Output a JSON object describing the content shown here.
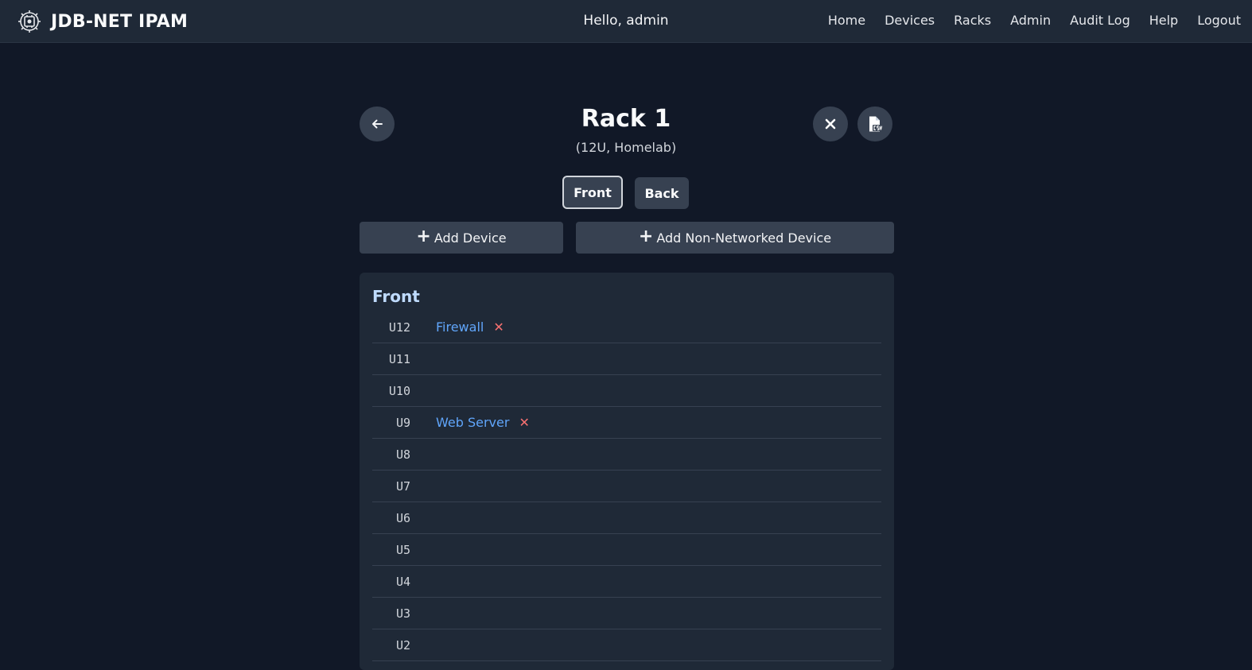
{
  "nav": {
    "brand": "JDB-NET IPAM",
    "greeting": "Hello, admin",
    "links": [
      "Home",
      "Devices",
      "Racks",
      "Admin",
      "Audit Log",
      "Help",
      "Logout"
    ]
  },
  "rack": {
    "title": "Rack 1",
    "subtitle": "(12U, Homelab)"
  },
  "views": {
    "front_label": "Front",
    "back_label": "Back",
    "active": "Front"
  },
  "actions": {
    "add_device": "Add Device",
    "add_non_networked": "Add Non-Networked Device"
  },
  "panel": {
    "title": "Front",
    "slots": [
      {
        "unit": "U12",
        "device": "Firewall"
      },
      {
        "unit": "U11",
        "device": ""
      },
      {
        "unit": "U10",
        "device": ""
      },
      {
        "unit": "U9",
        "device": "Web Server"
      },
      {
        "unit": "U8",
        "device": ""
      },
      {
        "unit": "U7",
        "device": ""
      },
      {
        "unit": "U6",
        "device": ""
      },
      {
        "unit": "U5",
        "device": ""
      },
      {
        "unit": "U4",
        "device": ""
      },
      {
        "unit": "U3",
        "device": ""
      },
      {
        "unit": "U2",
        "device": ""
      }
    ]
  },
  "icons": {
    "logo": "chip-gear-icon",
    "back": "arrow-left-icon",
    "close": "close-icon",
    "csv": "csv-file-icon",
    "remove": "remove-x-icon"
  },
  "colors": {
    "page_bg": "#111827",
    "nav_bg": "#1f2937",
    "button_bg": "#374151",
    "link": "#60a5fa",
    "danger": "#f87171",
    "panel_title": "#bfdbfe"
  }
}
